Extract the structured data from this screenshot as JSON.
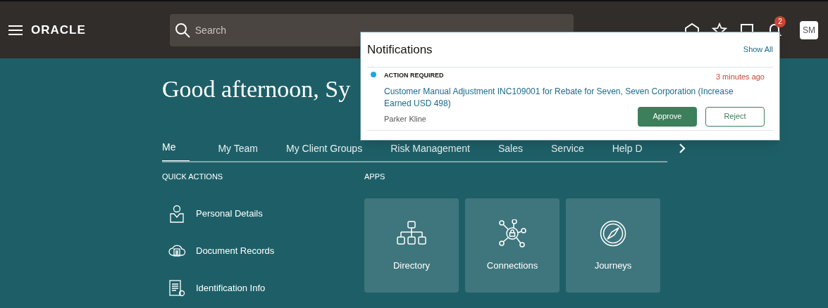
{
  "header": {
    "logo": "ORACLE",
    "search": {
      "placeholder": "Search"
    },
    "notification_count": "2",
    "avatar": "SM"
  },
  "notifications": {
    "title": "Notifications",
    "show_all": "Show All",
    "items": [
      {
        "unread": true,
        "category": "ACTION REQUIRED",
        "time": "3 minutes ago",
        "message": "Customer Manual Adjustment INC109001 for Rebate for Seven, Seven Corporation (Increase Earned USD 498)",
        "sender": "Parker Kline",
        "actions": [
          "Approve",
          "Reject"
        ]
      }
    ]
  },
  "greeting": "Good afternoon, Sy",
  "tabs": [
    {
      "label": "Me",
      "selected": true
    },
    {
      "label": "My Team",
      "selected": false
    },
    {
      "label": "My Client Groups",
      "selected": false
    },
    {
      "label": "Risk Management",
      "selected": false
    },
    {
      "label": "Sales",
      "selected": false
    },
    {
      "label": "Service",
      "selected": false
    },
    {
      "label": "Help D",
      "selected": false
    }
  ],
  "quick_actions": {
    "title": "QUICK ACTIONS",
    "items": [
      {
        "kind": "person",
        "label": "Personal Details"
      },
      {
        "kind": "cloud",
        "label": "Document Records"
      },
      {
        "kind": "document",
        "label": "Identification Info"
      }
    ]
  },
  "apps": {
    "title": "APPS",
    "items": [
      {
        "kind": "directory",
        "label": "Directory"
      },
      {
        "kind": "connections",
        "label": "Connections"
      },
      {
        "kind": "journeys",
        "label": "Journeys"
      }
    ]
  }
}
